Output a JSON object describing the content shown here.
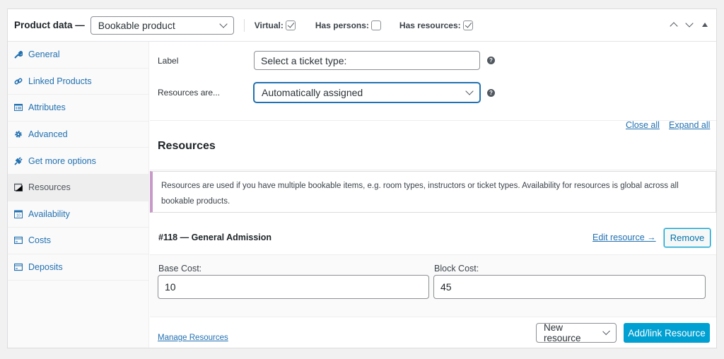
{
  "header": {
    "title": "Product data —",
    "product_type": "Bookable product",
    "checkboxes": [
      {
        "label": "Virtual:",
        "checked": true
      },
      {
        "label": "Has persons:",
        "checked": false
      },
      {
        "label": "Has resources:",
        "checked": true
      }
    ]
  },
  "sidebar": {
    "items": [
      {
        "label": "General",
        "icon": "wrench-icon"
      },
      {
        "label": "Linked Products",
        "icon": "link-icon"
      },
      {
        "label": "Attributes",
        "icon": "list-icon"
      },
      {
        "label": "Advanced",
        "icon": "gear-icon"
      },
      {
        "label": "Get more options",
        "icon": "plug-icon"
      },
      {
        "label": "Resources",
        "icon": "window-icon",
        "active": true
      },
      {
        "label": "Availability",
        "icon": "calendar-icon"
      },
      {
        "label": "Costs",
        "icon": "card-icon"
      },
      {
        "label": "Deposits",
        "icon": "card-icon"
      }
    ]
  },
  "main": {
    "label_field": {
      "label": "Label",
      "value": "Select a ticket type:"
    },
    "assign_field": {
      "label": "Resources are...",
      "value": "Automatically assigned"
    },
    "heading": "Resources",
    "close_all": "Close all",
    "expand_all": "Expand all",
    "notice": "Resources are used if you have multiple bookable items, e.g. room types, instructors or ticket types. Availability for resources is global across all bookable products.",
    "resource": {
      "title": "#118 — General Admission",
      "edit": "Edit resource →",
      "remove": "Remove",
      "base_cost_label": "Base Cost:",
      "base_cost": "10",
      "block_cost_label": "Block Cost:",
      "block_cost": "45"
    },
    "footer": {
      "manage": "Manage Resources",
      "new_resource": "New resource",
      "add_link": "Add/link Resource"
    }
  },
  "colors": {
    "link": "#2271b1",
    "primary": "#00a0d2",
    "notice_border": "#c89ac8"
  }
}
